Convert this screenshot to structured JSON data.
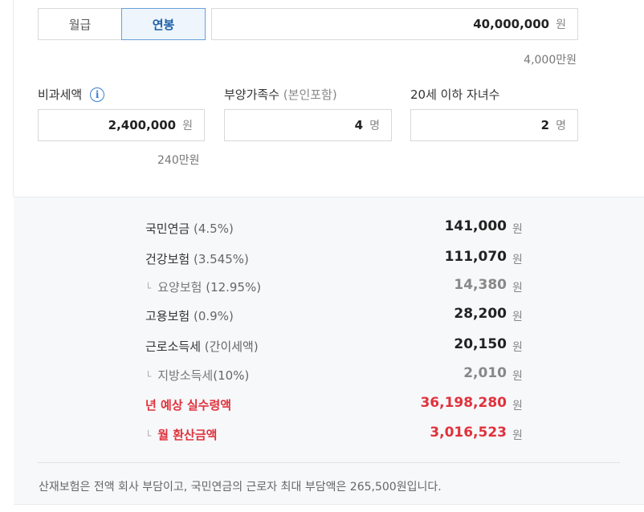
{
  "toggle": {
    "monthly": "월급",
    "annual": "연봉"
  },
  "salary": {
    "value": "40,000,000",
    "unit": "원",
    "hint": "4,000만원"
  },
  "fields": {
    "nontax": {
      "label": "비과세액",
      "value": "2,400,000",
      "unit": "원",
      "hint": "240만원"
    },
    "dependents": {
      "label": "부양가족수",
      "label_paren": "(본인포함)",
      "value": "4",
      "unit": "명"
    },
    "children": {
      "label": "20세 이하 자녀수",
      "value": "2",
      "unit": "명"
    }
  },
  "results": [
    {
      "label": "국민연금",
      "pct": "(4.5%)",
      "value": "141,000",
      "unit": "원"
    },
    {
      "label": "건강보험",
      "pct": "(3.545%)",
      "value": "111,070",
      "unit": "원"
    },
    {
      "label": "요양보험",
      "pct": "(12.95%)",
      "value": "14,380",
      "unit": "원"
    },
    {
      "label": "고용보험",
      "pct": "(0.9%)",
      "value": "28,200",
      "unit": "원"
    },
    {
      "label": "근로소득세",
      "pct": "(간이세액)",
      "value": "20,150",
      "unit": "원"
    },
    {
      "label": "지방소득세",
      "pct": "(10%)",
      "value": "2,010",
      "unit": "원"
    },
    {
      "label": "년 예상 실수령액",
      "pct": "",
      "value": "36,198,280",
      "unit": "원"
    },
    {
      "label": "월 환산금액",
      "pct": "",
      "value": "3,016,523",
      "unit": "원"
    }
  ],
  "footnote": "산재보험은 전액 회사 부담이고, 국민연금의 근로자 최대 부담액은 265,500원입니다.",
  "icons": {
    "info": "info-icon",
    "sub_marker": "└"
  },
  "colors": {
    "accent": "#1d5fa8",
    "highlight": "#e0323c"
  }
}
